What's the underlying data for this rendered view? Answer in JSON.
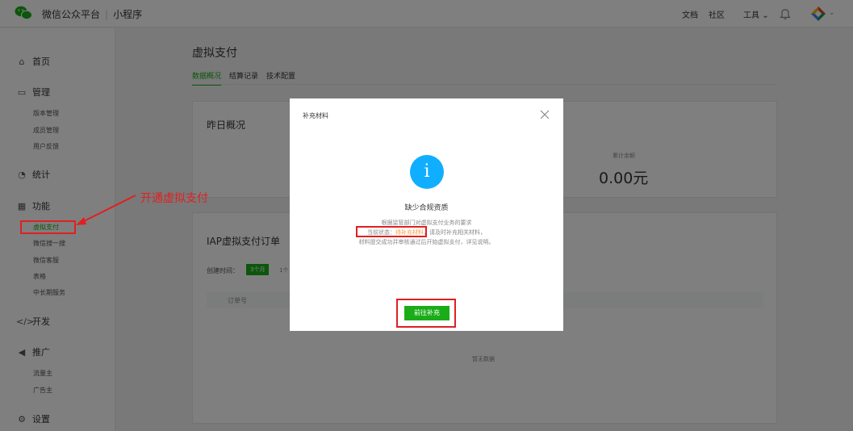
{
  "topbar": {
    "brand": "微信公众平台",
    "separator": "|",
    "product": "小程序",
    "links": [
      "文档",
      "社区",
      "工具"
    ],
    "tools_chevron": "⌄",
    "avatar_chevron": "⌄"
  },
  "sidebar": {
    "sections": [
      {
        "icon": "home-icon",
        "label": "首页"
      },
      {
        "icon": "management-icon",
        "label": "管理"
      },
      {
        "icon": "statistics-icon",
        "label": "统计"
      },
      {
        "icon": "function-icon",
        "label": "功能"
      },
      {
        "icon": "develop-icon",
        "label": "开发"
      },
      {
        "icon": "promote-icon",
        "label": "推广"
      },
      {
        "icon": "settings-icon",
        "label": "设置"
      }
    ],
    "management_items": [
      "版本管理",
      "成员管理",
      "用户反馈"
    ],
    "function_items": [
      "虚拟支付",
      "微信搜一搜",
      "微信客服",
      "表格",
      "中长期服务"
    ],
    "promote_items": [
      "流量主",
      "广告主"
    ],
    "active_item": "虚拟支付"
  },
  "main": {
    "title": "虚拟支付",
    "tabs": [
      "数据概况",
      "结算记录",
      "技术配置"
    ],
    "yesterday": {
      "title": "昨日概况",
      "balance_label": "累计余额",
      "balance_value": "0.00元"
    },
    "orders": {
      "title": "IAP虚拟支付订单",
      "filter_label": "创建时间：",
      "filter_selected": "3个月",
      "filter_more": "1个",
      "column": "订单号",
      "empty": "暂无数据"
    }
  },
  "modal": {
    "title": "补充材料",
    "heading": "缺少合规资质",
    "line1": "根据监管部门对虚拟支付业务的要求",
    "status_label": "当前状态：",
    "status_value": "待补充材料",
    "line2_rest": "，请及时补充相关材料，",
    "line3": "材料提交成功并审核通过后开始虚拟支付，详见说明。",
    "button": "前往补充"
  },
  "annotation": {
    "text": "开通虚拟支付"
  },
  "colors": {
    "accent": "#1aad19",
    "info": "#10aeff",
    "annotation": "#e02020",
    "status": "#fa9d3b"
  }
}
